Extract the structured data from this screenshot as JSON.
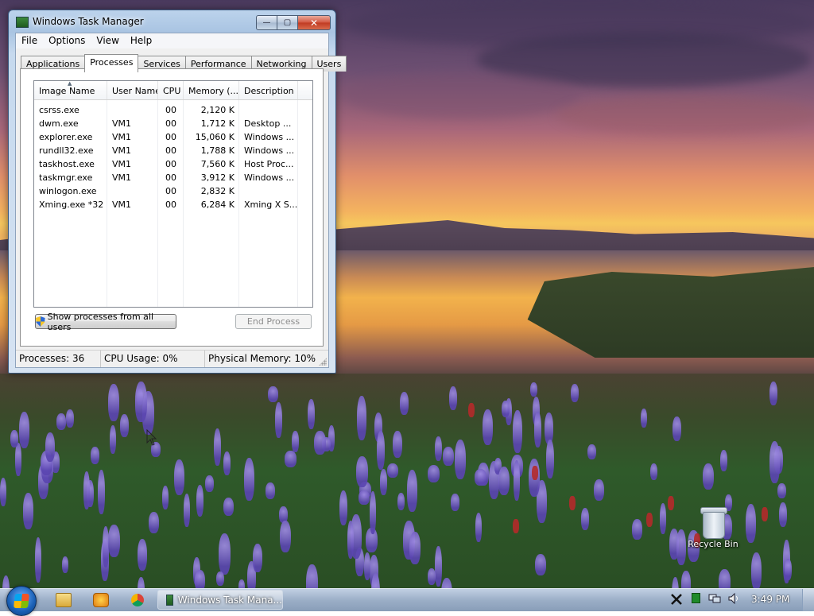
{
  "window": {
    "title": "Windows Task Manager",
    "buttons": {
      "minimize": "—",
      "maximize": "▢",
      "close": "✕"
    }
  },
  "menu": [
    "File",
    "Options",
    "View",
    "Help"
  ],
  "tabs": [
    "Applications",
    "Processes",
    "Services",
    "Performance",
    "Networking",
    "Users"
  ],
  "active_tab": "Processes",
  "columns": [
    "Image Name",
    "User Name",
    "CPU",
    "Memory (...",
    "Description"
  ],
  "processes": [
    {
      "image": "csrss.exe",
      "user": "",
      "cpu": "00",
      "memory": "2,120 K",
      "description": ""
    },
    {
      "image": "dwm.exe",
      "user": "VM1",
      "cpu": "00",
      "memory": "1,712 K",
      "description": "Desktop ..."
    },
    {
      "image": "explorer.exe",
      "user": "VM1",
      "cpu": "00",
      "memory": "15,060 K",
      "description": "Windows ..."
    },
    {
      "image": "rundll32.exe",
      "user": "VM1",
      "cpu": "00",
      "memory": "1,788 K",
      "description": "Windows ..."
    },
    {
      "image": "taskhost.exe",
      "user": "VM1",
      "cpu": "00",
      "memory": "7,560 K",
      "description": "Host Proc..."
    },
    {
      "image": "taskmgr.exe",
      "user": "VM1",
      "cpu": "00",
      "memory": "3,912 K",
      "description": "Windows ..."
    },
    {
      "image": "winlogon.exe",
      "user": "",
      "cpu": "00",
      "memory": "2,832 K",
      "description": ""
    },
    {
      "image": "Xming.exe *32",
      "user": "VM1",
      "cpu": "00",
      "memory": "6,284 K",
      "description": "Xming X S..."
    }
  ],
  "buttons": {
    "show_all": "Show processes from all users",
    "end_process": "End Process"
  },
  "status": {
    "processes": "Processes: 36",
    "cpu": "CPU Usage: 0%",
    "memory": "Physical Memory: 10%"
  },
  "desktop": {
    "recycle_bin": "Recycle Bin"
  },
  "taskbar": {
    "active_window": "Windows Task Mana...",
    "clock": "3:49 PM"
  }
}
